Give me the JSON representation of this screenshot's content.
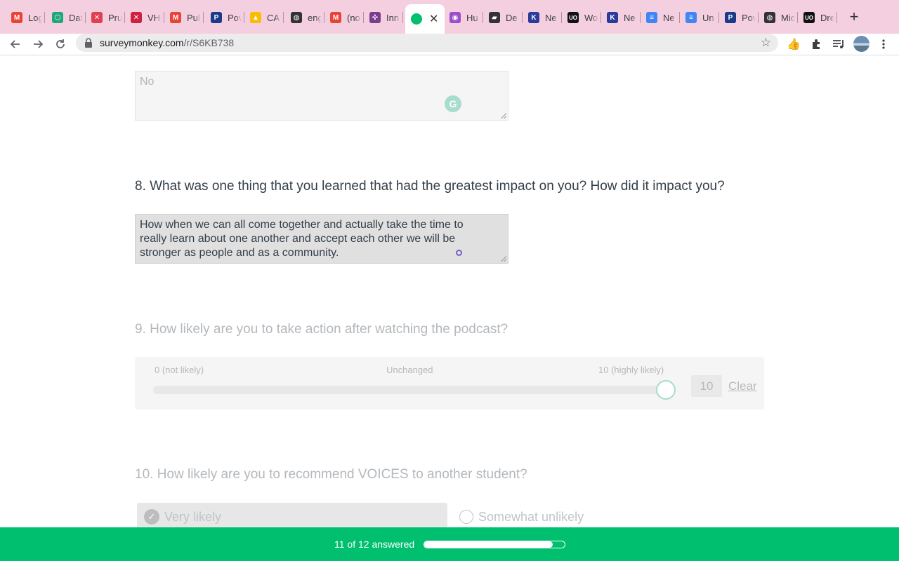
{
  "browser": {
    "tabs": [
      {
        "title": "Log",
        "icon": "gmail-icon",
        "color": "#ea4335",
        "glyph": "M"
      },
      {
        "title": "Dat",
        "icon": "hexagon-icon",
        "color": "#20a779",
        "glyph": "⬡"
      },
      {
        "title": "Pru",
        "icon": "pru-icon",
        "color": "#e04050",
        "glyph": "✕"
      },
      {
        "title": "VHI",
        "icon": "vh-icon",
        "color": "#d02040",
        "glyph": "✕"
      },
      {
        "title": "Pul",
        "icon": "gmail-icon",
        "color": "#ea4335",
        "glyph": "M"
      },
      {
        "title": "Pov",
        "icon": "p-icon",
        "color": "#1a3a8a",
        "glyph": "P"
      },
      {
        "title": "CA",
        "icon": "drive-icon",
        "color": "#fbbc04",
        "glyph": "▲"
      },
      {
        "title": "eng",
        "icon": "globe-icon",
        "color": "#333333",
        "glyph": "◍"
      },
      {
        "title": "(no",
        "icon": "gmail-icon",
        "color": "#ea4335",
        "glyph": "M"
      },
      {
        "title": "Inn",
        "icon": "nodes-icon",
        "color": "#7a3c8c",
        "glyph": "✣"
      },
      {
        "title": "Hu",
        "icon": "podcast-icon",
        "color": "#9b4dca",
        "glyph": "◉"
      },
      {
        "title": "De",
        "icon": "cap-icon",
        "color": "#333333",
        "glyph": "▰"
      },
      {
        "title": "Ne",
        "icon": "k-icon",
        "color": "#2a3b9c",
        "glyph": "K"
      },
      {
        "title": "Wo",
        "icon": "uo-icon",
        "color": "#111111",
        "glyph": "UO"
      },
      {
        "title": "Ne",
        "icon": "k-icon",
        "color": "#2a3b9c",
        "glyph": "K"
      },
      {
        "title": "Ne",
        "icon": "docs-icon",
        "color": "#4285f4",
        "glyph": "≡"
      },
      {
        "title": "Un",
        "icon": "docs-icon",
        "color": "#4285f4",
        "glyph": "≡"
      },
      {
        "title": "Pov",
        "icon": "p-icon",
        "color": "#1a3a8a",
        "glyph": "P"
      },
      {
        "title": "Mic",
        "icon": "globe-icon",
        "color": "#333333",
        "glyph": "◍"
      },
      {
        "title": "Dre",
        "icon": "uo-icon",
        "color": "#111111",
        "glyph": "UO"
      }
    ],
    "active_tab": {
      "icon": "surveymonkey-icon",
      "color": "#00bf6f"
    },
    "url_host": "surveymonkey.com",
    "url_path": "/r/S6KB738"
  },
  "survey": {
    "prev_answer_placeholder": "No",
    "q8": {
      "label": "8. What was one thing that you learned that had the greatest impact on you? How did it impact you?",
      "answer": "How when we can all come together and actually take the time to really learn about one another and accept each other we will be stronger as people and as a community."
    },
    "q9": {
      "label": "9. How likely are you to take action after watching the podcast?",
      "min_label": "0 (not likely)",
      "mid_label": "Unchanged",
      "max_label": "10 (highly likely)",
      "value": "10",
      "value_fraction": 1.0,
      "clear_label": "Clear"
    },
    "q10": {
      "label": "10. How likely are you to recommend VOICES to another student?",
      "options": [
        "Very likely",
        "Somewhat unlikely"
      ],
      "selected": "Very likely"
    }
  },
  "progress": {
    "text": "11 of 12 answered",
    "fraction": 0.917,
    "color": "#00bf6f"
  }
}
